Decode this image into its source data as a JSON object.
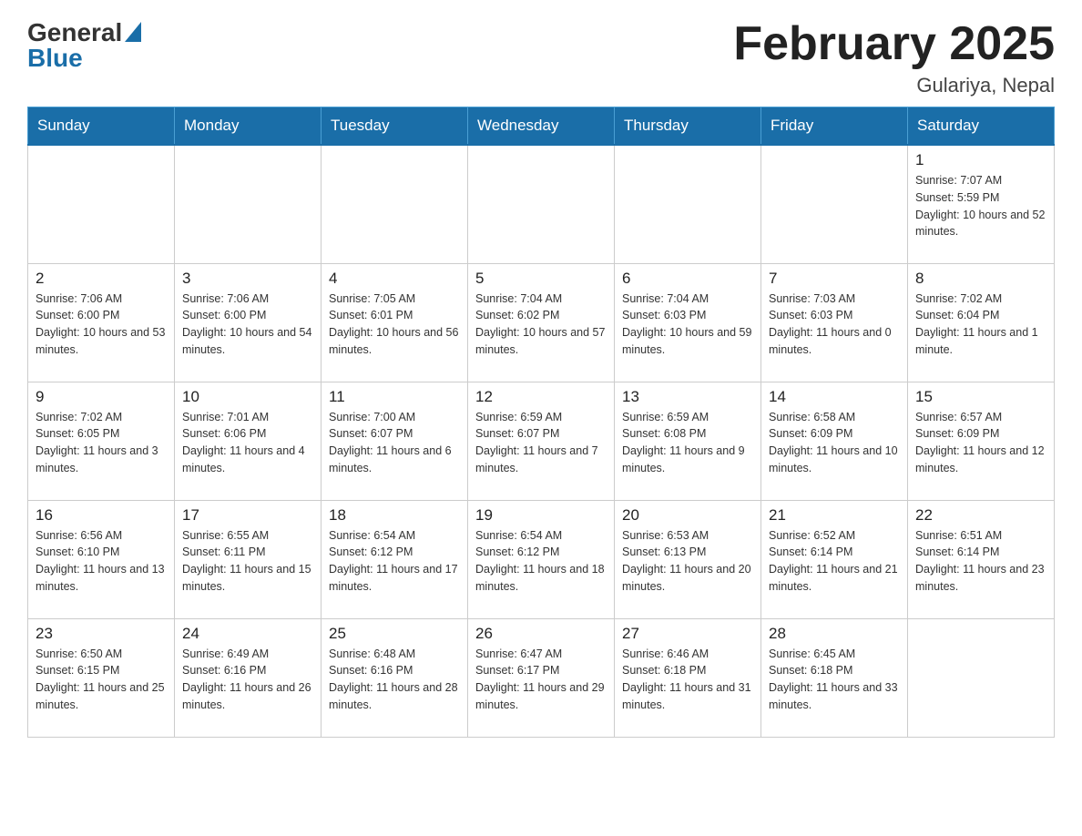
{
  "header": {
    "logo_general": "General",
    "logo_blue": "Blue",
    "month_title": "February 2025",
    "location": "Gulariya, Nepal"
  },
  "days_of_week": [
    "Sunday",
    "Monday",
    "Tuesday",
    "Wednesday",
    "Thursday",
    "Friday",
    "Saturday"
  ],
  "weeks": [
    {
      "days": [
        {
          "num": "",
          "sunrise": "",
          "sunset": "",
          "daylight": ""
        },
        {
          "num": "",
          "sunrise": "",
          "sunset": "",
          "daylight": ""
        },
        {
          "num": "",
          "sunrise": "",
          "sunset": "",
          "daylight": ""
        },
        {
          "num": "",
          "sunrise": "",
          "sunset": "",
          "daylight": ""
        },
        {
          "num": "",
          "sunrise": "",
          "sunset": "",
          "daylight": ""
        },
        {
          "num": "",
          "sunrise": "",
          "sunset": "",
          "daylight": ""
        },
        {
          "num": "1",
          "sunrise": "Sunrise: 7:07 AM",
          "sunset": "Sunset: 5:59 PM",
          "daylight": "Daylight: 10 hours and 52 minutes."
        }
      ]
    },
    {
      "days": [
        {
          "num": "2",
          "sunrise": "Sunrise: 7:06 AM",
          "sunset": "Sunset: 6:00 PM",
          "daylight": "Daylight: 10 hours and 53 minutes."
        },
        {
          "num": "3",
          "sunrise": "Sunrise: 7:06 AM",
          "sunset": "Sunset: 6:00 PM",
          "daylight": "Daylight: 10 hours and 54 minutes."
        },
        {
          "num": "4",
          "sunrise": "Sunrise: 7:05 AM",
          "sunset": "Sunset: 6:01 PM",
          "daylight": "Daylight: 10 hours and 56 minutes."
        },
        {
          "num": "5",
          "sunrise": "Sunrise: 7:04 AM",
          "sunset": "Sunset: 6:02 PM",
          "daylight": "Daylight: 10 hours and 57 minutes."
        },
        {
          "num": "6",
          "sunrise": "Sunrise: 7:04 AM",
          "sunset": "Sunset: 6:03 PM",
          "daylight": "Daylight: 10 hours and 59 minutes."
        },
        {
          "num": "7",
          "sunrise": "Sunrise: 7:03 AM",
          "sunset": "Sunset: 6:03 PM",
          "daylight": "Daylight: 11 hours and 0 minutes."
        },
        {
          "num": "8",
          "sunrise": "Sunrise: 7:02 AM",
          "sunset": "Sunset: 6:04 PM",
          "daylight": "Daylight: 11 hours and 1 minute."
        }
      ]
    },
    {
      "days": [
        {
          "num": "9",
          "sunrise": "Sunrise: 7:02 AM",
          "sunset": "Sunset: 6:05 PM",
          "daylight": "Daylight: 11 hours and 3 minutes."
        },
        {
          "num": "10",
          "sunrise": "Sunrise: 7:01 AM",
          "sunset": "Sunset: 6:06 PM",
          "daylight": "Daylight: 11 hours and 4 minutes."
        },
        {
          "num": "11",
          "sunrise": "Sunrise: 7:00 AM",
          "sunset": "Sunset: 6:07 PM",
          "daylight": "Daylight: 11 hours and 6 minutes."
        },
        {
          "num": "12",
          "sunrise": "Sunrise: 6:59 AM",
          "sunset": "Sunset: 6:07 PM",
          "daylight": "Daylight: 11 hours and 7 minutes."
        },
        {
          "num": "13",
          "sunrise": "Sunrise: 6:59 AM",
          "sunset": "Sunset: 6:08 PM",
          "daylight": "Daylight: 11 hours and 9 minutes."
        },
        {
          "num": "14",
          "sunrise": "Sunrise: 6:58 AM",
          "sunset": "Sunset: 6:09 PM",
          "daylight": "Daylight: 11 hours and 10 minutes."
        },
        {
          "num": "15",
          "sunrise": "Sunrise: 6:57 AM",
          "sunset": "Sunset: 6:09 PM",
          "daylight": "Daylight: 11 hours and 12 minutes."
        }
      ]
    },
    {
      "days": [
        {
          "num": "16",
          "sunrise": "Sunrise: 6:56 AM",
          "sunset": "Sunset: 6:10 PM",
          "daylight": "Daylight: 11 hours and 13 minutes."
        },
        {
          "num": "17",
          "sunrise": "Sunrise: 6:55 AM",
          "sunset": "Sunset: 6:11 PM",
          "daylight": "Daylight: 11 hours and 15 minutes."
        },
        {
          "num": "18",
          "sunrise": "Sunrise: 6:54 AM",
          "sunset": "Sunset: 6:12 PM",
          "daylight": "Daylight: 11 hours and 17 minutes."
        },
        {
          "num": "19",
          "sunrise": "Sunrise: 6:54 AM",
          "sunset": "Sunset: 6:12 PM",
          "daylight": "Daylight: 11 hours and 18 minutes."
        },
        {
          "num": "20",
          "sunrise": "Sunrise: 6:53 AM",
          "sunset": "Sunset: 6:13 PM",
          "daylight": "Daylight: 11 hours and 20 minutes."
        },
        {
          "num": "21",
          "sunrise": "Sunrise: 6:52 AM",
          "sunset": "Sunset: 6:14 PM",
          "daylight": "Daylight: 11 hours and 21 minutes."
        },
        {
          "num": "22",
          "sunrise": "Sunrise: 6:51 AM",
          "sunset": "Sunset: 6:14 PM",
          "daylight": "Daylight: 11 hours and 23 minutes."
        }
      ]
    },
    {
      "days": [
        {
          "num": "23",
          "sunrise": "Sunrise: 6:50 AM",
          "sunset": "Sunset: 6:15 PM",
          "daylight": "Daylight: 11 hours and 25 minutes."
        },
        {
          "num": "24",
          "sunrise": "Sunrise: 6:49 AM",
          "sunset": "Sunset: 6:16 PM",
          "daylight": "Daylight: 11 hours and 26 minutes."
        },
        {
          "num": "25",
          "sunrise": "Sunrise: 6:48 AM",
          "sunset": "Sunset: 6:16 PM",
          "daylight": "Daylight: 11 hours and 28 minutes."
        },
        {
          "num": "26",
          "sunrise": "Sunrise: 6:47 AM",
          "sunset": "Sunset: 6:17 PM",
          "daylight": "Daylight: 11 hours and 29 minutes."
        },
        {
          "num": "27",
          "sunrise": "Sunrise: 6:46 AM",
          "sunset": "Sunset: 6:18 PM",
          "daylight": "Daylight: 11 hours and 31 minutes."
        },
        {
          "num": "28",
          "sunrise": "Sunrise: 6:45 AM",
          "sunset": "Sunset: 6:18 PM",
          "daylight": "Daylight: 11 hours and 33 minutes."
        },
        {
          "num": "",
          "sunrise": "",
          "sunset": "",
          "daylight": ""
        }
      ]
    }
  ]
}
